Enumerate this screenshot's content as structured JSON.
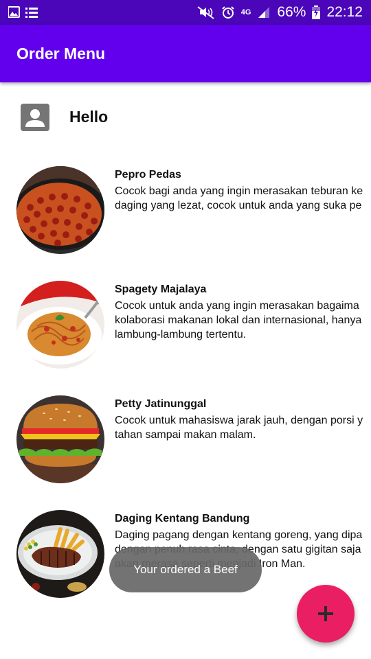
{
  "status_bar": {
    "network": "4G",
    "battery": "66%",
    "time": "22:12",
    "icons": [
      "image-icon",
      "list-icon",
      "mute-icon",
      "alarm-icon",
      "signal-icon",
      "battery-icon"
    ]
  },
  "app_bar": {
    "title": "Order Menu"
  },
  "header": {
    "greeting": "Hello",
    "icon": "account-box-icon"
  },
  "menu": {
    "items": [
      {
        "name": "Pepro Pedas",
        "lines": [
          "Cocok bagi anda yang ingin merasakan teburan ke",
          "daging yang lezat, cocok untuk anda yang suka pe"
        ]
      },
      {
        "name": "Spagety Majalaya",
        "lines": [
          "Cocok untuk anda yang ingin merasakan bagaima",
          "kolaborasi makanan lokal dan internasional, hanya",
          "lambung-lambung tertentu."
        ]
      },
      {
        "name": "Petty Jatinunggal",
        "lines": [
          "Cocok untuk mahasiswa jarak jauh, dengan porsi y",
          "tahan sampai makan malam."
        ]
      },
      {
        "name": "Daging Kentang Bandung",
        "lines": [
          "Daging pagang dengan kentang goreng, yang dipa",
          "dengan penuh rasa cinta, dengan satu gigitan saja",
          "akan merasa seperti menjadi Iron Man."
        ]
      }
    ]
  },
  "toast": {
    "message": "Your ordered a Beef"
  },
  "fab": {
    "icon": "add-icon"
  },
  "colors": {
    "status_bar": "#4a06b8",
    "app_bar": "#6200ee",
    "fab": "#e91e63",
    "toast": "#676767"
  }
}
